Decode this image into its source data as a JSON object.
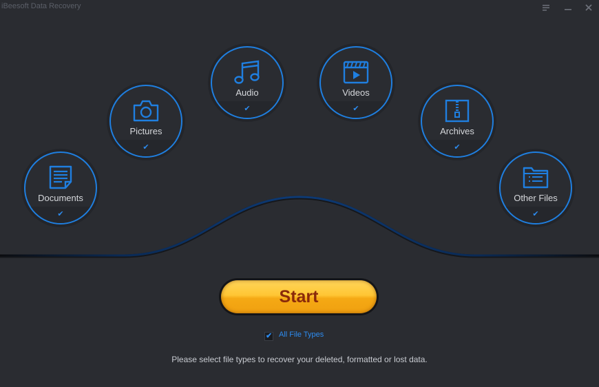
{
  "window": {
    "title": "iBeesoft Data Recovery",
    "menu_icon": "menu-icon",
    "minimize_icon": "minimize-icon",
    "close_icon": "close-icon"
  },
  "colors": {
    "accent": "#1f7fe0",
    "check": "#2d8cf0",
    "background": "#2a2c31",
    "start_button": "#ffc634",
    "start_text": "#8a2a0a"
  },
  "categories": [
    {
      "label": "Documents",
      "icon": "document-icon",
      "checked": true
    },
    {
      "label": "Pictures",
      "icon": "camera-icon",
      "checked": true
    },
    {
      "label": "Audio",
      "icon": "music-note-icon",
      "checked": true
    },
    {
      "label": "Videos",
      "icon": "video-clapper-icon",
      "checked": true
    },
    {
      "label": "Archives",
      "icon": "archive-zip-icon",
      "checked": true
    },
    {
      "label": "Other Files",
      "icon": "folder-list-icon",
      "checked": true
    }
  ],
  "check_glyph": "✔",
  "start_button": {
    "label": "Start"
  },
  "all_file_types": {
    "label": "All File Types",
    "checked": true
  },
  "hint": "Please select file types to recover your deleted, formatted or lost data."
}
